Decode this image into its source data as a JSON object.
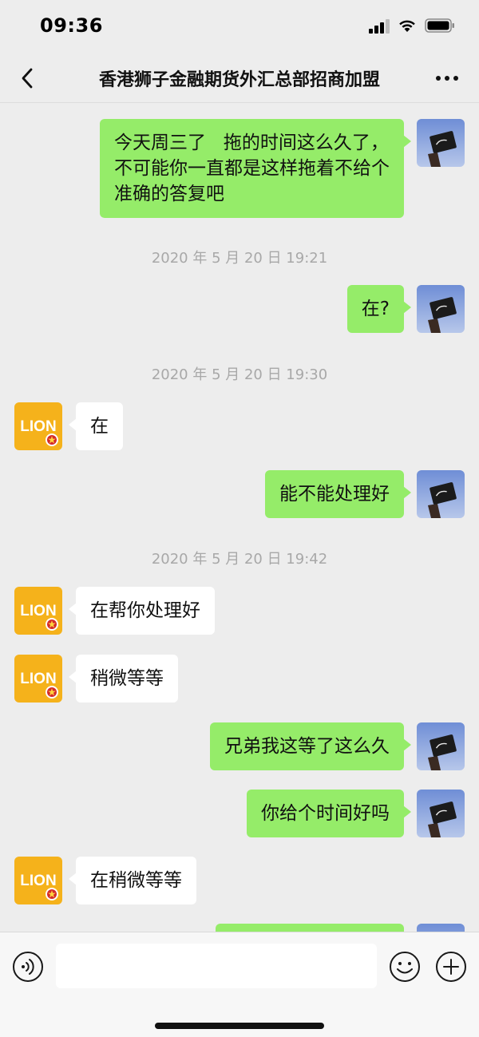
{
  "status_bar": {
    "time": "09:36"
  },
  "nav": {
    "title": "香港狮子金融期货外汇总部招商加盟",
    "back_icon": "chevron-left-icon",
    "more_icon": "more-dots-icon"
  },
  "colors": {
    "self_bubble": "#95ec69",
    "other_bubble": "#ffffff",
    "background": "#ededed",
    "lion_avatar_bg": "#f5b21b"
  },
  "messages": [
    {
      "sender": "self",
      "text": "今天周三了   拖的时间这么久了，\n不可能你一直都是这样拖着不给个\n准确的答复吧"
    },
    {
      "type": "timestamp",
      "text": "2020 年 5 月 20 日 19:21"
    },
    {
      "sender": "self",
      "text": "在?"
    },
    {
      "type": "timestamp",
      "text": "2020 年 5 月 20 日 19:30"
    },
    {
      "sender": "other",
      "text": "在"
    },
    {
      "sender": "self",
      "text": "能不能处理好"
    },
    {
      "type": "timestamp",
      "text": "2020 年 5 月 20 日 19:42"
    },
    {
      "sender": "other",
      "text": "在帮你处理好"
    },
    {
      "sender": "other",
      "text": "稍微等等"
    },
    {
      "sender": "self",
      "text": "兄弟我这等了这么久"
    },
    {
      "sender": "self",
      "text": "你给个时间好吗"
    },
    {
      "sender": "other",
      "text": "在稍微等等"
    },
    {
      "sender": "self",
      "text": ""
    }
  ],
  "other_avatar_text": "LION",
  "input": {
    "value": "",
    "placeholder": ""
  }
}
